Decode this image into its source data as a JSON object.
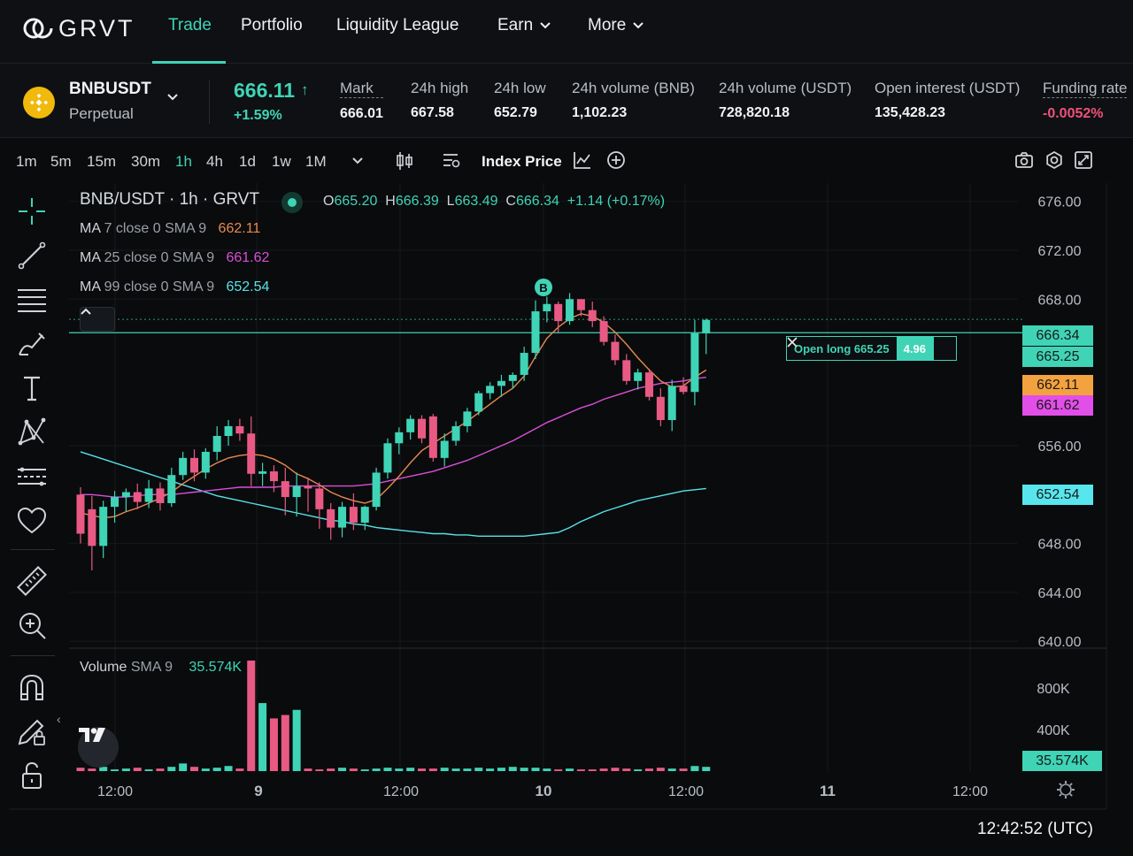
{
  "nav": {
    "logo": "GRVT",
    "items": [
      {
        "label": "Trade",
        "active": true
      },
      {
        "label": "Portfolio"
      },
      {
        "label": "Liquidity League"
      },
      {
        "label": "Earn",
        "dropdown": true
      },
      {
        "label": "More",
        "dropdown": true
      }
    ]
  },
  "ticker": {
    "symbol": "BNBUSDT",
    "type": "Perpetual",
    "last_price": "666.11",
    "change": "+1.59%",
    "stats": [
      {
        "label": "Mark",
        "value": "666.01"
      },
      {
        "label": "24h high",
        "value": "667.58"
      },
      {
        "label": "24h low",
        "value": "652.79"
      },
      {
        "label": "24h volume (BNB)",
        "value": "1,102.23"
      },
      {
        "label": "24h volume (USDT)",
        "value": "728,820.18"
      },
      {
        "label": "Open interest (USDT)",
        "value": "135,428.23"
      },
      {
        "label": "Funding rate",
        "value": "-0.0052%"
      }
    ]
  },
  "toolbar": {
    "timeframes": [
      "1m",
      "5m",
      "15m",
      "30m",
      "1h",
      "4h",
      "1d",
      "1w",
      "1M"
    ],
    "active_timeframe": "1h",
    "index_price": "Index Price"
  },
  "legend": {
    "title": "BNB/USDT · 1h · GRVT",
    "ohlc": {
      "o": "665.20",
      "h": "666.39",
      "l": "663.49",
      "c": "666.34",
      "change": "+1.14 (+0.17%)"
    },
    "ma": [
      {
        "label": "MA",
        "params": "7 close 0 SMA 9",
        "value": "662.11",
        "color": "#e8894f"
      },
      {
        "label": "MA",
        "params": "25 close 0 SMA 9",
        "value": "661.62",
        "color": "#d94fd8"
      },
      {
        "label": "MA",
        "params": "99 close 0 SMA 9",
        "value": "652.54",
        "color": "#56e3e8"
      }
    ],
    "volume": {
      "label": "Volume",
      "params": "SMA 9",
      "value": "35.574K"
    }
  },
  "order_line": {
    "label": "Open long 665.25",
    "qty": "4.96",
    "price": 665.25
  },
  "price_tags": [
    {
      "value": "666.34",
      "bg": "#3fd4b6"
    },
    {
      "value": "665.25",
      "bg": "#3fd4b6"
    },
    {
      "value": "662.11",
      "bg": "#f3a23f"
    },
    {
      "value": "661.62",
      "bg": "#e24ee8"
    },
    {
      "value": "652.54",
      "bg": "#57e6ee"
    }
  ],
  "volume_tag": "35.574K",
  "marker": "B",
  "clock": "12:42:52 (UTC)",
  "colors": {
    "up": "#3fd4b6",
    "down": "#e85a84",
    "accent": "#3fd4b6"
  },
  "chart_data": {
    "type": "candlestick",
    "symbol": "BNB/USDT",
    "interval": "1h",
    "price_axis": {
      "ticks": [
        "676.00",
        "672.00",
        "668.00",
        "656.00",
        "648.00",
        "644.00",
        "640.00"
      ],
      "range": [
        639.5,
        677.5
      ]
    },
    "volume_axis": {
      "ticks": [
        "800K",
        "400K"
      ]
    },
    "x_ticks": [
      "12:00",
      "9",
      "12:00",
      "10",
      "12:00",
      "11",
      "12:00"
    ],
    "candles": [
      [
        652.0,
        652.6,
        648.0,
        648.8
      ],
      [
        650.8,
        651.9,
        645.8,
        647.8
      ],
      [
        647.8,
        651.5,
        646.8,
        651.0
      ],
      [
        651.0,
        652.3,
        649.7,
        651.8
      ],
      [
        651.8,
        652.5,
        650.6,
        652.2
      ],
      [
        652.2,
        652.9,
        650.8,
        651.4
      ],
      [
        651.4,
        653.2,
        650.9,
        652.5
      ],
      [
        652.5,
        653.0,
        650.7,
        651.3
      ],
      [
        651.3,
        654.2,
        651.0,
        653.6
      ],
      [
        653.6,
        655.5,
        653.2,
        655.0
      ],
      [
        655.0,
        655.7,
        653.1,
        653.8
      ],
      [
        653.8,
        655.8,
        653.3,
        655.5
      ],
      [
        655.5,
        657.6,
        654.8,
        656.8
      ],
      [
        656.8,
        658.1,
        656.0,
        657.6
      ],
      [
        657.6,
        658.2,
        656.4,
        657.0
      ],
      [
        657.0,
        658.4,
        652.7,
        653.7
      ],
      [
        653.7,
        654.6,
        652.7,
        653.9
      ],
      [
        653.9,
        654.4,
        652.2,
        653.1
      ],
      [
        653.1,
        654.2,
        650.3,
        651.8
      ],
      [
        651.8,
        653.8,
        650.2,
        652.7
      ],
      [
        652.7,
        653.4,
        650.6,
        652.5
      ],
      [
        652.5,
        653.0,
        649.2,
        650.8
      ],
      [
        650.8,
        651.3,
        648.3,
        649.3
      ],
      [
        649.3,
        651.4,
        648.5,
        651.0
      ],
      [
        651.0,
        652.1,
        649.1,
        649.7
      ],
      [
        649.7,
        651.1,
        649.1,
        651.0
      ],
      [
        651.0,
        654.2,
        650.7,
        653.8
      ],
      [
        653.8,
        656.6,
        653.3,
        656.2
      ],
      [
        656.2,
        657.5,
        655.3,
        657.1
      ],
      [
        657.1,
        658.5,
        656.5,
        658.2
      ],
      [
        658.2,
        658.5,
        656.2,
        656.6
      ],
      [
        658.4,
        658.6,
        654.7,
        655.0
      ],
      [
        655.0,
        657.0,
        654.3,
        656.4
      ],
      [
        656.4,
        658.0,
        656.0,
        657.6
      ],
      [
        657.6,
        659.1,
        657.1,
        658.8
      ],
      [
        658.8,
        660.5,
        658.5,
        660.3
      ],
      [
        660.3,
        661.2,
        659.8,
        660.9
      ],
      [
        660.9,
        661.8,
        660.0,
        661.3
      ],
      [
        661.3,
        662.0,
        660.7,
        661.8
      ],
      [
        661.8,
        664.1,
        661.3,
        663.6
      ],
      [
        663.6,
        667.9,
        663.1,
        667.0
      ],
      [
        667.0,
        668.2,
        666.1,
        667.6
      ],
      [
        667.6,
        667.8,
        665.3,
        666.2
      ],
      [
        666.2,
        668.5,
        665.9,
        668.0
      ],
      [
        668.0,
        668.0,
        666.6,
        667.1
      ],
      [
        667.1,
        667.8,
        665.7,
        666.2
      ],
      [
        666.2,
        666.6,
        664.2,
        664.5
      ],
      [
        664.5,
        665.1,
        662.6,
        663.0
      ],
      [
        663.0,
        663.5,
        661.0,
        661.3
      ],
      [
        661.3,
        662.3,
        660.6,
        662.0
      ],
      [
        662.0,
        662.3,
        659.7,
        660.0
      ],
      [
        660.0,
        660.7,
        657.6,
        658.1
      ],
      [
        658.1,
        661.4,
        657.2,
        660.9
      ],
      [
        660.9,
        661.6,
        660.2,
        660.4
      ],
      [
        660.4,
        666.3,
        659.3,
        665.2
      ],
      [
        665.2,
        666.4,
        663.5,
        666.3
      ]
    ],
    "volumes": [
      4,
      3,
      5,
      2,
      3,
      4,
      2,
      3,
      5,
      9,
      5,
      3,
      4,
      6,
      3,
      4,
      3,
      2,
      3,
      2,
      3,
      2,
      3,
      4,
      3,
      2,
      3,
      4,
      3,
      4,
      3,
      3,
      4,
      3,
      3,
      4,
      3,
      4,
      5,
      4,
      4,
      3,
      2,
      3,
      2,
      2,
      3,
      4,
      3,
      2,
      3,
      4,
      3,
      3,
      6,
      5
    ],
    "volume_spikes": {
      "15": 130,
      "16": 80,
      "17": 62,
      "18": 66,
      "19": 72
    },
    "volume_max": 130,
    "ma7": [
      650.5,
      650.3,
      650.1,
      650.2,
      650.6,
      650.9,
      651.3,
      651.7,
      652.2,
      652.9,
      653.5,
      654.1,
      654.6,
      655.0,
      655.2,
      655.3,
      655.2,
      654.9,
      654.4,
      653.7,
      653.3,
      652.8,
      652.2,
      651.8,
      651.5,
      651.3,
      651.6,
      652.5,
      653.5,
      654.6,
      655.6,
      656.2,
      656.8,
      657.4,
      658.0,
      658.7,
      659.4,
      660.1,
      660.7,
      661.7,
      663.3,
      664.8,
      665.7,
      666.4,
      666.8,
      666.6,
      666.1,
      665.3,
      664.3,
      663.2,
      662.2,
      661.3,
      660.8,
      660.9,
      661.6,
      662.2
    ],
    "ma25": [
      652.0,
      652.0,
      651.9,
      651.8,
      651.8,
      651.9,
      652.0,
      652.0,
      652.0,
      652.1,
      652.2,
      652.3,
      652.4,
      652.5,
      652.6,
      652.6,
      652.6,
      652.6,
      652.7,
      652.7,
      652.7,
      652.7,
      652.7,
      652.7,
      652.7,
      652.8,
      652.9,
      653.1,
      653.3,
      653.5,
      653.7,
      653.9,
      654.2,
      654.5,
      654.8,
      655.2,
      655.6,
      656.0,
      656.4,
      656.9,
      657.4,
      657.9,
      658.3,
      658.7,
      659.1,
      659.4,
      659.8,
      660.1,
      660.4,
      660.7,
      660.9,
      661.1,
      661.2,
      661.3,
      661.5,
      661.6
    ],
    "ma99": [
      655.5,
      655.2,
      654.9,
      654.6,
      654.3,
      654.0,
      653.7,
      653.4,
      653.1,
      652.8,
      652.5,
      652.2,
      651.9,
      651.7,
      651.5,
      651.3,
      651.1,
      650.9,
      650.7,
      650.5,
      650.3,
      650.1,
      649.9,
      649.8,
      649.6,
      649.5,
      649.3,
      649.2,
      649.1,
      649.0,
      648.9,
      648.8,
      648.8,
      648.7,
      648.7,
      648.6,
      648.6,
      648.6,
      648.6,
      648.6,
      648.7,
      648.8,
      648.9,
      649.3,
      649.8,
      650.2,
      650.6,
      650.9,
      651.2,
      651.5,
      651.7,
      651.9,
      652.1,
      652.3,
      652.4,
      652.5
    ]
  }
}
